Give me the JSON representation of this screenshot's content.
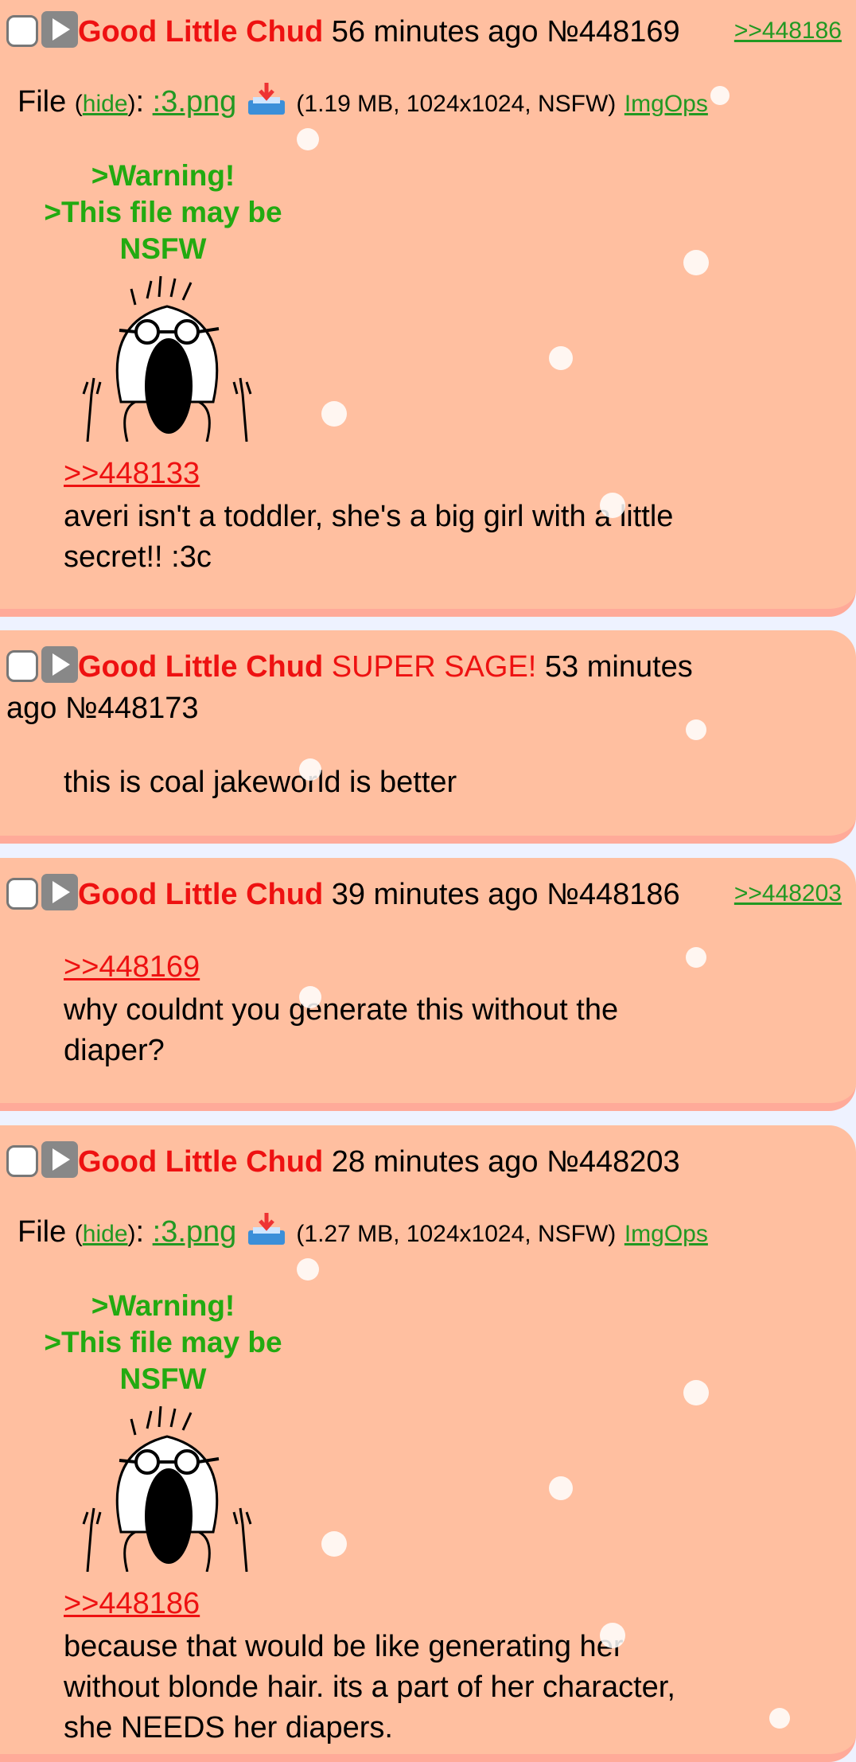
{
  "colors": {
    "post_bg": "#ffbfa0",
    "post_border": "#ffaa99",
    "name": "#ee1111",
    "link_green": "#229922",
    "warning_green": "#22aa11",
    "quote_red": "#ee1111"
  },
  "posts": [
    {
      "name": "Good Little Chud",
      "time": "56 minutes ago",
      "number": "№448169",
      "backlink": ">>448186",
      "file_label": "File",
      "hide_label": "hide",
      "filename": ":3.png",
      "file_meta": "(1.19 MB, 1024x1024, NSFW)",
      "imgops": "ImgOps",
      "warning": [
        ">Warning!",
        ">This file may be",
        "NSFW"
      ],
      "quote": ">>448133",
      "message": [
        "averi isn't a toddler, she's a big girl with a little",
        "secret!! :3c"
      ]
    },
    {
      "name": "Good Little Chud",
      "sage": "SUPER SAGE!",
      "time_line1": "53 minutes",
      "time_line2": "ago",
      "number": "№448173",
      "message": [
        "this is coal jakeworld is better"
      ]
    },
    {
      "name": "Good Little Chud",
      "time": "39 minutes ago",
      "number": "№448186",
      "backlink": ">>448203",
      "quote": ">>448169",
      "message": [
        "why couldnt you generate this without the",
        "diaper?"
      ]
    },
    {
      "name": "Good Little Chud",
      "time": "28 minutes ago",
      "number": "№448203",
      "file_label": "File",
      "hide_label": "hide",
      "filename": ":3.png",
      "file_meta": "(1.27 MB, 1024x1024, NSFW)",
      "imgops": "ImgOps",
      "warning": [
        ">Warning!",
        ">This file may be",
        "NSFW"
      ],
      "quote": ">>448186",
      "message": [
        "because that would be like generating her",
        "without blonde hair. its a part of her character,",
        "she NEEDS her diapers."
      ]
    }
  ],
  "icons": {
    "checkbox": "checkbox-icon",
    "play": "play-icon",
    "download": "download-icon",
    "thumbnail": "soyjak-thumbnail",
    "snow": "snowflake-icon"
  }
}
